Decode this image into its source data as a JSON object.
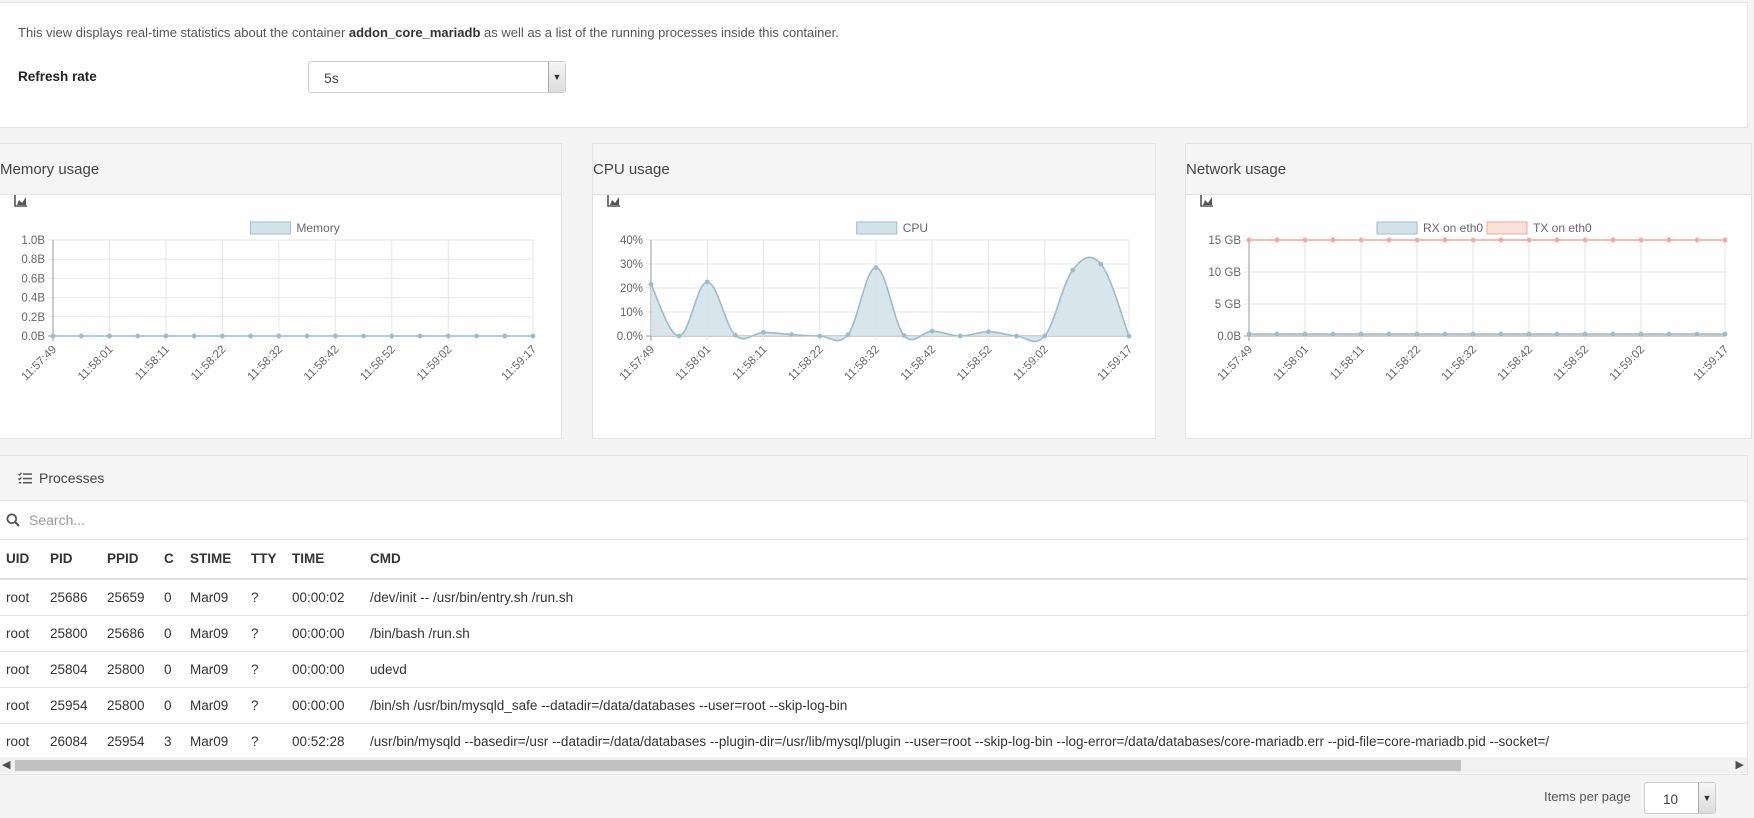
{
  "intro": {
    "prefix": "This view displays real-time statistics about the container ",
    "container_name": "addon_core_mariadb",
    "suffix": " as well as a list of the running processes inside this container."
  },
  "refresh": {
    "label": "Refresh rate",
    "value": "5s"
  },
  "widgets": {
    "memory": {
      "title": "Memory usage",
      "icon": "area-chart-icon"
    },
    "cpu": {
      "title": "CPU usage",
      "icon": "area-chart-icon"
    },
    "network": {
      "title": "Network usage",
      "icon": "area-chart-icon"
    }
  },
  "chart_data": [
    {
      "type": "area",
      "x": [
        "11:57:49",
        "11:57:55",
        "11:58:01",
        "11:58:06",
        "11:58:11",
        "11:58:16",
        "11:58:22",
        "11:58:27",
        "11:58:32",
        "11:58:37",
        "11:58:42",
        "11:58:47",
        "11:58:52",
        "11:58:57",
        "11:59:02",
        "11:59:07",
        "11:59:12",
        "11:59:17"
      ],
      "tick_labels": [
        "11:57:49",
        "11:58:01",
        "11:58:11",
        "11:58:22",
        "11:58:32",
        "11:58:42",
        "11:58:52",
        "11:59:02",
        "11:59:17"
      ],
      "series": [
        {
          "name": "Memory",
          "values": [
            0,
            0,
            0,
            0,
            0,
            0,
            0,
            0,
            0,
            0,
            0,
            0,
            0,
            0,
            0,
            0,
            0,
            0
          ]
        }
      ],
      "y_ticks": [
        "0.0B",
        "0.2B",
        "0.4B",
        "0.6B",
        "0.8B",
        "1.0B"
      ],
      "ylim": [
        0,
        1
      ],
      "grid": true,
      "legend": "top"
    },
    {
      "type": "area",
      "x": [
        "11:57:49",
        "11:57:55",
        "11:58:01",
        "11:58:06",
        "11:58:11",
        "11:58:16",
        "11:58:22",
        "11:58:27",
        "11:58:32",
        "11:58:37",
        "11:58:42",
        "11:58:47",
        "11:58:52",
        "11:58:57",
        "11:59:02",
        "11:59:07",
        "11:59:12",
        "11:59:17"
      ],
      "tick_labels": [
        "11:57:49",
        "11:58:01",
        "11:58:11",
        "11:58:22",
        "11:58:32",
        "11:58:42",
        "11:58:52",
        "11:59:02",
        "11:59:17"
      ],
      "series": [
        {
          "name": "CPU",
          "values": [
            21.5,
            0,
            22.5,
            0.3,
            1.5,
            0.6,
            0,
            0.5,
            28.5,
            0.2,
            2,
            0,
            1.8,
            0,
            0,
            27.5,
            30,
            0
          ]
        }
      ],
      "y_ticks": [
        "0.0%",
        "10%",
        "20%",
        "30%",
        "40%"
      ],
      "ylim": [
        0,
        40
      ],
      "grid": true,
      "legend": "top"
    },
    {
      "type": "line",
      "x": [
        "11:57:49",
        "11:57:55",
        "11:58:01",
        "11:58:06",
        "11:58:11",
        "11:58:16",
        "11:58:22",
        "11:58:27",
        "11:58:32",
        "11:58:37",
        "11:58:42",
        "11:58:47",
        "11:58:52",
        "11:58:57",
        "11:59:02",
        "11:59:07",
        "11:59:12",
        "11:59:17"
      ],
      "tick_labels": [
        "11:57:49",
        "11:58:01",
        "11:58:11",
        "11:58:22",
        "11:58:32",
        "11:58:42",
        "11:58:52",
        "11:59:02",
        "11:59:17"
      ],
      "series": [
        {
          "name": "RX on eth0",
          "values": [
            0.3,
            0.3,
            0.3,
            0.3,
            0.3,
            0.3,
            0.3,
            0.3,
            0.3,
            0.3,
            0.3,
            0.3,
            0.3,
            0.3,
            0.3,
            0.3,
            0.3,
            0.3
          ]
        },
        {
          "name": "TX on eth0",
          "values": [
            15,
            15,
            15,
            15,
            15,
            15,
            15,
            15,
            15,
            15,
            15,
            15,
            15,
            15,
            15,
            15,
            15,
            15
          ]
        }
      ],
      "y_ticks": [
        "0.0B",
        "5 GB",
        "10 GB",
        "15 GB"
      ],
      "ylim": [
        0,
        15
      ],
      "grid": true,
      "legend": "top"
    }
  ],
  "processes": {
    "title": "Processes",
    "search_placeholder": "Search...",
    "columns": [
      "UID",
      "PID",
      "PPID",
      "C",
      "STIME",
      "TTY",
      "TIME",
      "CMD"
    ],
    "rows": [
      [
        "root",
        "25686",
        "25659",
        "0",
        "Mar09",
        "?",
        "00:00:02",
        "/dev/init -- /usr/bin/entry.sh /run.sh"
      ],
      [
        "root",
        "25800",
        "25686",
        "0",
        "Mar09",
        "?",
        "00:00:00",
        "/bin/bash /run.sh"
      ],
      [
        "root",
        "25804",
        "25800",
        "0",
        "Mar09",
        "?",
        "00:00:00",
        "udevd"
      ],
      [
        "root",
        "25954",
        "25800",
        "0",
        "Mar09",
        "?",
        "00:00:00",
        "/bin/sh /usr/bin/mysqld_safe --datadir=/data/databases --user=root --skip-log-bin"
      ],
      [
        "root",
        "26084",
        "25954",
        "3",
        "Mar09",
        "?",
        "00:52:28",
        "/usr/bin/mysqld --basedir=/usr --datadir=/data/databases --plugin-dir=/usr/lib/mysql/plugin --user=root --skip-log-bin --log-error=/data/databases/core-mariadb.err --pid-file=core-mariadb.pid --socket=/"
      ]
    ]
  },
  "pagination": {
    "label": "Items per page",
    "value": "10"
  },
  "colors": {
    "blue_line": "#9bbccd",
    "blue_fill": "#d4e3ea",
    "red_line": "#f4a79c",
    "red_fill": "#fde1dc",
    "grid": "#e6e6e6"
  }
}
